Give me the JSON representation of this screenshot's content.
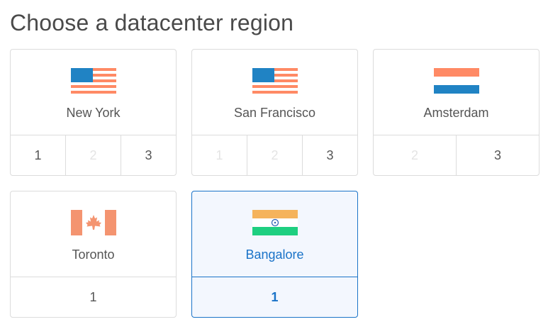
{
  "page": {
    "title": "Choose a datacenter region"
  },
  "regions": [
    {
      "name": "New York",
      "flag": "us-flag",
      "datacenters": [
        {
          "label": "1",
          "enabled": true
        },
        {
          "label": "2",
          "enabled": false
        },
        {
          "label": "3",
          "enabled": true
        }
      ]
    },
    {
      "name": "San Francisco",
      "flag": "us-flag",
      "datacenters": [
        {
          "label": "1",
          "enabled": false
        },
        {
          "label": "2",
          "enabled": false
        },
        {
          "label": "3",
          "enabled": true
        }
      ]
    },
    {
      "name": "Amsterdam",
      "flag": "nl-flag",
      "datacenters": [
        {
          "label": "2",
          "enabled": false
        },
        {
          "label": "3",
          "enabled": true
        }
      ]
    },
    {
      "name": "Toronto",
      "flag": "ca-flag",
      "datacenters": [
        {
          "label": "1",
          "enabled": true
        }
      ]
    },
    {
      "name": "Bangalore",
      "flag": "in-flag",
      "selected": true,
      "datacenters": [
        {
          "label": "1",
          "enabled": true
        }
      ]
    }
  ],
  "colors": {
    "accent": "#1a73c8",
    "flag_blue": "#2083c4",
    "flag_red": "#ff8a65",
    "flag_saffron": "#f5b35b",
    "flag_green": "#1ecf80"
  }
}
